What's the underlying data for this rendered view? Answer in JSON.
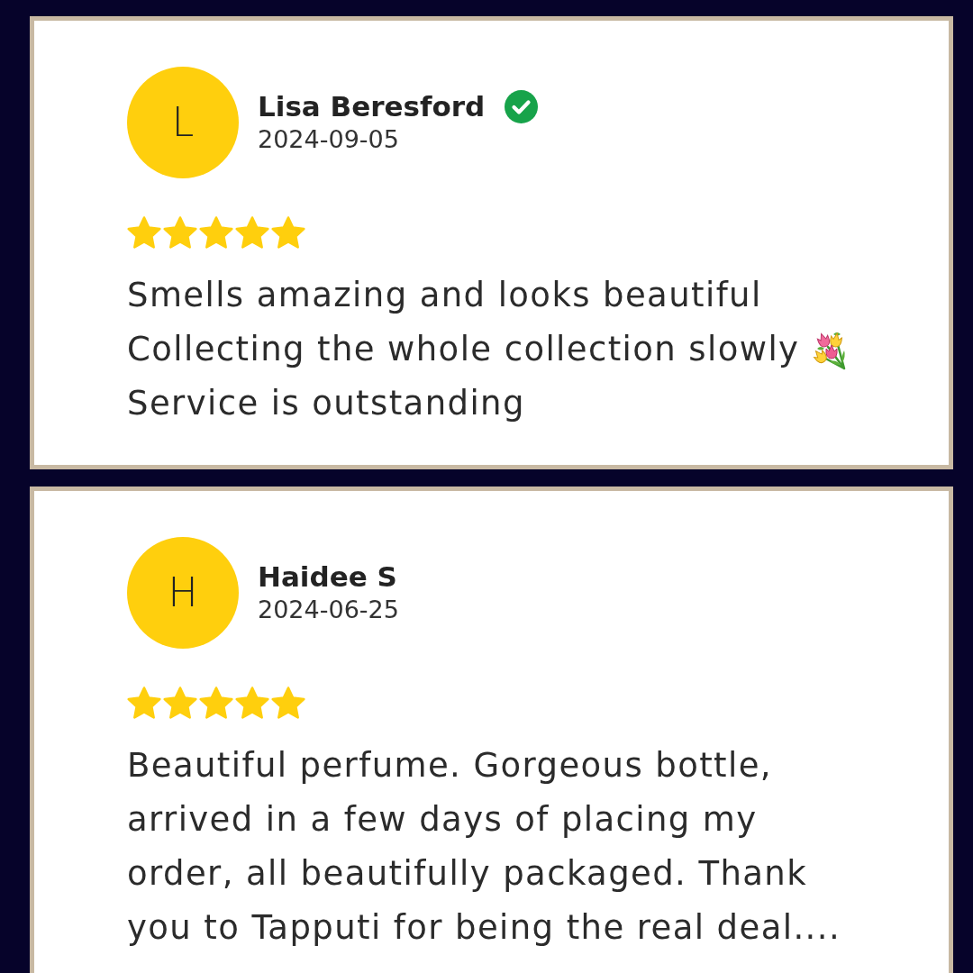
{
  "reviews": [
    {
      "initial": "L",
      "name": "Lisa Beresford",
      "verified": true,
      "date": "2024-09-05",
      "stars": 5,
      "body": [
        {
          "kind": "text",
          "text": "Smells amazing and looks beautiful"
        },
        {
          "kind": "text_emoji",
          "text": "Collecting the whole collection slowly"
        },
        {
          "kind": "text",
          "text": "Service is outstanding"
        }
      ]
    },
    {
      "initial": "H",
      "name": "Haidee S",
      "verified": false,
      "date": "2024-06-25",
      "stars": 5,
      "body": [
        {
          "kind": "text",
          "text": "Beautiful perfume. Gorgeous bottle,\narrived in a few days of placing my\norder, all beautifully packaged. Thank\nyou to Tapputi for being the real deal...."
        }
      ]
    }
  ]
}
